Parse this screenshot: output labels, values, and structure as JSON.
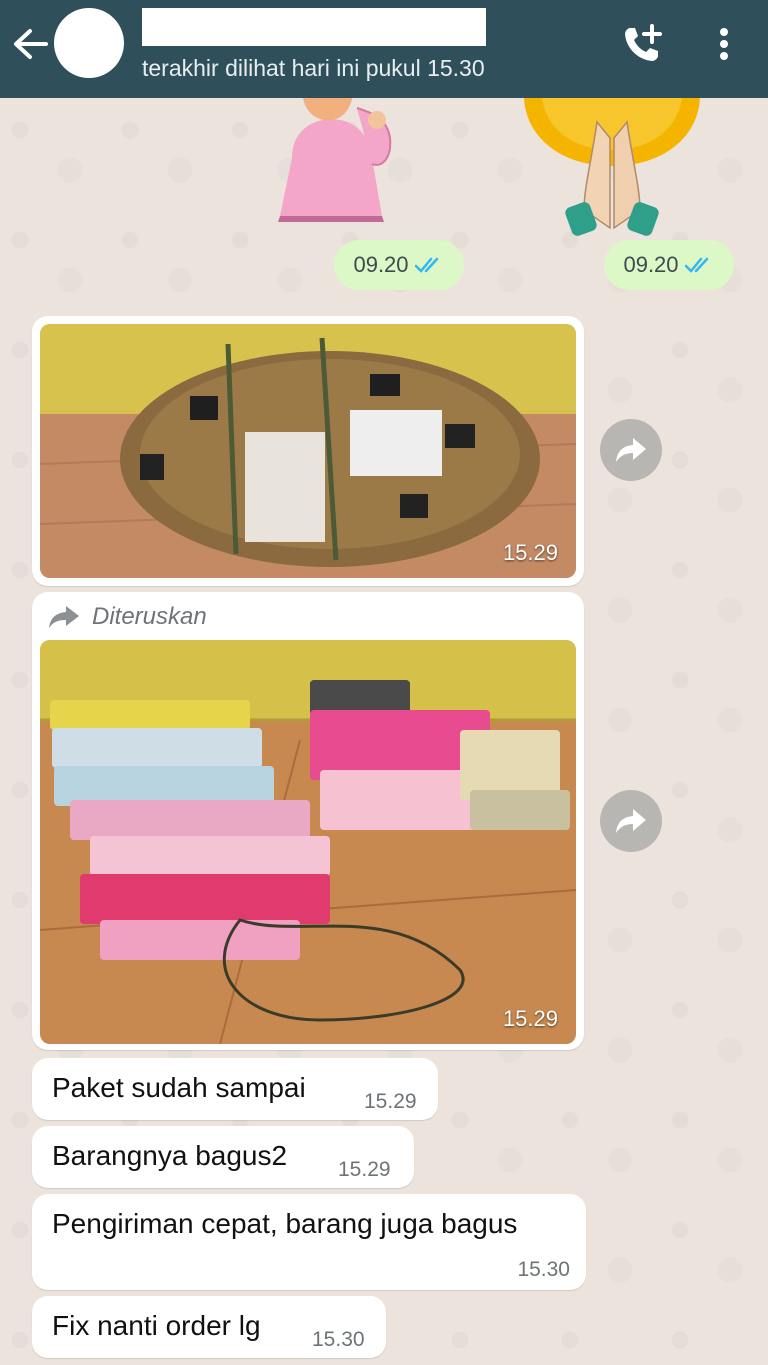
{
  "header": {
    "contact_name": "",
    "status": "terakhir dilihat hari ini pukul 15.30",
    "icons": [
      "back-arrow-icon",
      "add-call-icon",
      "more-vert-icon"
    ],
    "color": "#2f4f5b"
  },
  "sent_stickers": [
    {
      "time": "09.20",
      "status_icon": "double-check-icon"
    },
    {
      "time": "09.20",
      "status_icon": "double-check-icon"
    }
  ],
  "messages": {
    "photo1": {
      "time": "15.29"
    },
    "photo2": {
      "forwarded_label": "Diteruskan",
      "time": "15.29"
    },
    "text1": {
      "text": "Paket sudah sampai",
      "time": "15.29"
    },
    "text2": {
      "text": "Barangnya bagus2",
      "time": "15.29"
    },
    "text3": {
      "text": "Pengiriman cepat, barang juga bagus",
      "time": "15.30"
    },
    "text4": {
      "text": "Fix nanti order lg",
      "time": "15.30"
    }
  },
  "colors": {
    "outgoing_bubble": "#dcf8c6",
    "incoming_bubble": "#ffffff",
    "read_tick": "#34b7f1"
  }
}
